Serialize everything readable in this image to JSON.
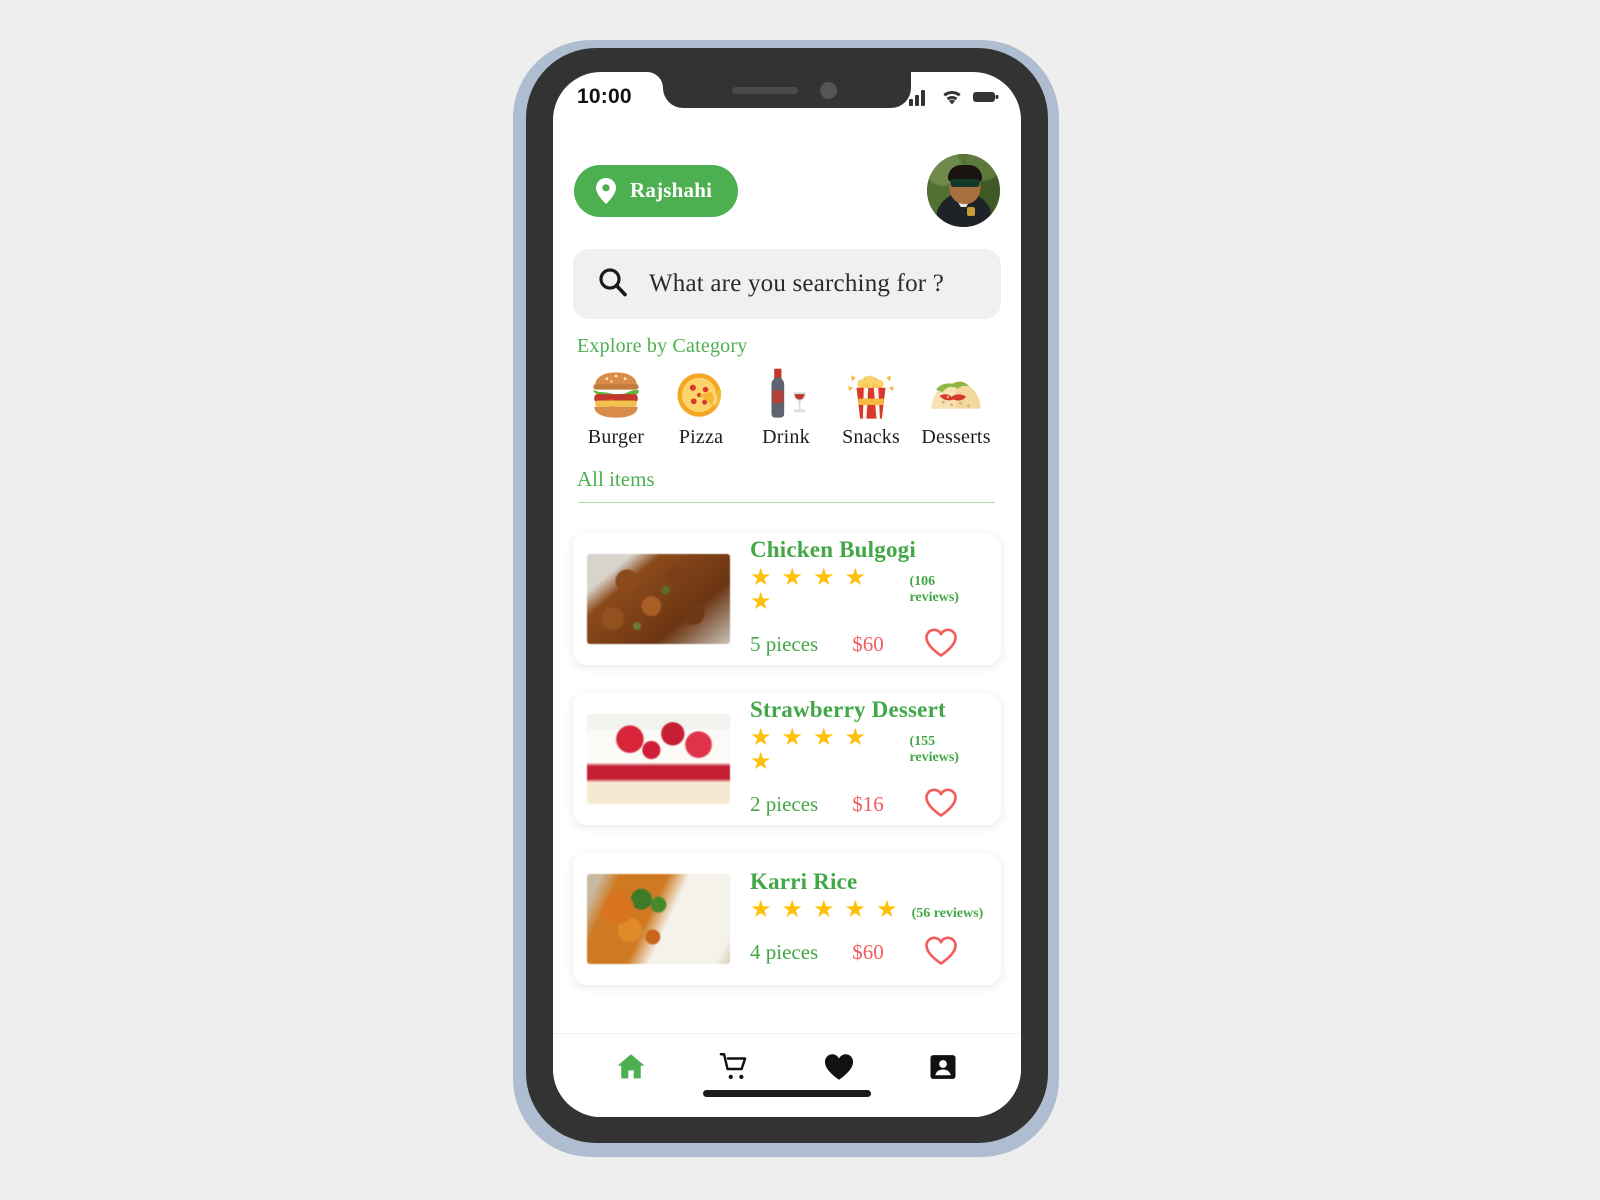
{
  "status_bar": {
    "time": "10:00",
    "icons": [
      "signal-icon",
      "wifi-icon",
      "battery-icon"
    ]
  },
  "header": {
    "location_label": "Rajshahi",
    "location_icon": "location-pin-icon",
    "avatar_name": "user-avatar"
  },
  "search": {
    "placeholder": "What are you searching for ?",
    "value": "",
    "icon": "search-icon"
  },
  "category_section": {
    "title": "Explore by Category",
    "items": [
      {
        "label": "Burger",
        "icon": "burger-icon"
      },
      {
        "label": "Pizza",
        "icon": "pizza-icon"
      },
      {
        "label": "Drink",
        "icon": "drink-icon"
      },
      {
        "label": "Snacks",
        "icon": "popcorn-icon"
      },
      {
        "label": "Desserts",
        "icon": "taco-icon"
      }
    ]
  },
  "all_items": {
    "title": "All items",
    "cards": [
      {
        "name": "Chicken Bulgogi",
        "stars": "★ ★ ★ ★ ★",
        "rating": 5,
        "reviews": "(106 reviews)",
        "review_count": 106,
        "pieces": "5 pieces",
        "price": "$60",
        "favorite_icon": "heart-outline-icon",
        "thumb": "chicken-bulgogi-photo"
      },
      {
        "name": "Strawberry Dessert",
        "stars": "★ ★ ★ ★ ★",
        "rating": 5,
        "reviews": "(155 reviews)",
        "review_count": 155,
        "pieces": "2 pieces",
        "price": "$16",
        "favorite_icon": "heart-outline-icon",
        "thumb": "strawberry-dessert-photo"
      },
      {
        "name": "Karri Rice",
        "stars": "★ ★ ★ ★ ★",
        "rating": 5,
        "reviews": "(56 reviews)",
        "review_count": 56,
        "pieces": "4 pieces",
        "price": "$60",
        "favorite_icon": "heart-outline-icon",
        "thumb": "karri-rice-photo"
      }
    ]
  },
  "bottom_nav": {
    "items": [
      {
        "name": "home",
        "icon": "home-icon",
        "active": true
      },
      {
        "name": "cart",
        "icon": "cart-icon",
        "active": false
      },
      {
        "name": "favorites",
        "icon": "heart-icon",
        "active": false
      },
      {
        "name": "profile",
        "icon": "contact-icon",
        "active": false
      }
    ]
  },
  "colors": {
    "brand_green": "#4caf50",
    "title_green": "#41a845",
    "price_red": "#f45b5b",
    "star_gold": "#ffc107",
    "search_bg": "#eef0f2",
    "page_bg": "#eeeeee",
    "phone_body": "#333333",
    "phone_edge": "#aebdcf"
  }
}
